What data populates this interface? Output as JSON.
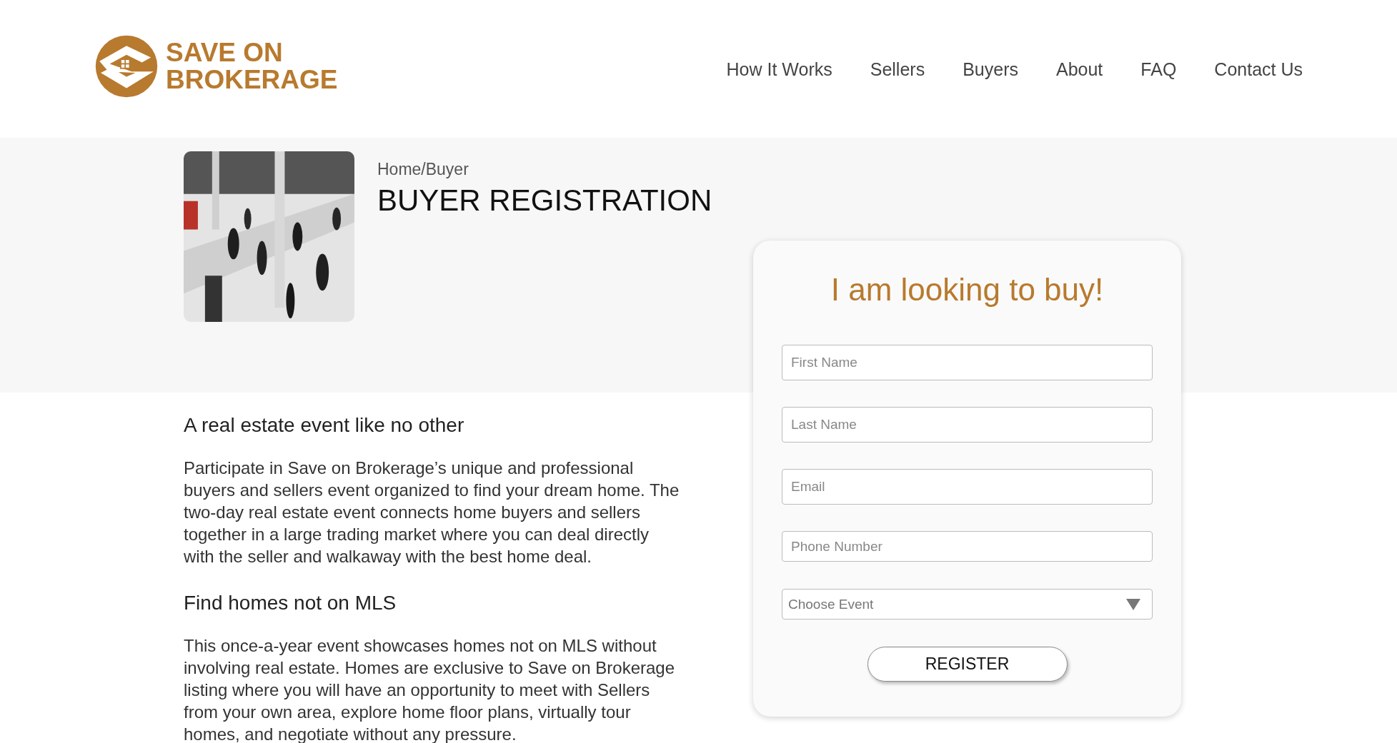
{
  "header": {
    "logo": {
      "line_1": "SAVE ON",
      "line_2": "BROKERAGE"
    },
    "nav": [
      {
        "label": "How It Works"
      },
      {
        "label": "Sellers"
      },
      {
        "label": "Buyers"
      },
      {
        "label": "About"
      },
      {
        "label": "FAQ"
      },
      {
        "label": "Contact Us"
      }
    ]
  },
  "hero": {
    "breadcrumb": "Home/Buyer",
    "title": "BUYER REGISTRATION"
  },
  "content": [
    {
      "kind": "heading",
      "text": "A real estate event like no other"
    },
    {
      "kind": "paragraph",
      "text": "Participate in Save on Brokerage’s unique and professional buyers and sellers event organized to find your dream home. The two-day real estate event connects home buyers and sellers together in a large trading market where you can deal directly with the seller and walkaway with the best home deal."
    },
    {
      "kind": "heading",
      "text": "Find homes not on MLS"
    },
    {
      "kind": "paragraph",
      "text": "This once-a-year event showcases homes not on MLS without involving real estate.  Homes are exclusive to Save on Brokerage listing where you will have an opportunity to meet with Sellers from your own area, explore home floor plans, virtually tour homes, and negotiate without any pressure."
    }
  ],
  "form": {
    "title": "I am looking to buy!",
    "fields": [
      {
        "kind": "input",
        "placeholder": "First Name"
      },
      {
        "kind": "input",
        "placeholder": "Last Name"
      },
      {
        "kind": "input",
        "placeholder": "Email"
      },
      {
        "kind": "input",
        "placeholder": "Phone Number"
      },
      {
        "kind": "select",
        "placeholder": "Choose Event"
      }
    ],
    "submit": "REGISTER"
  }
}
